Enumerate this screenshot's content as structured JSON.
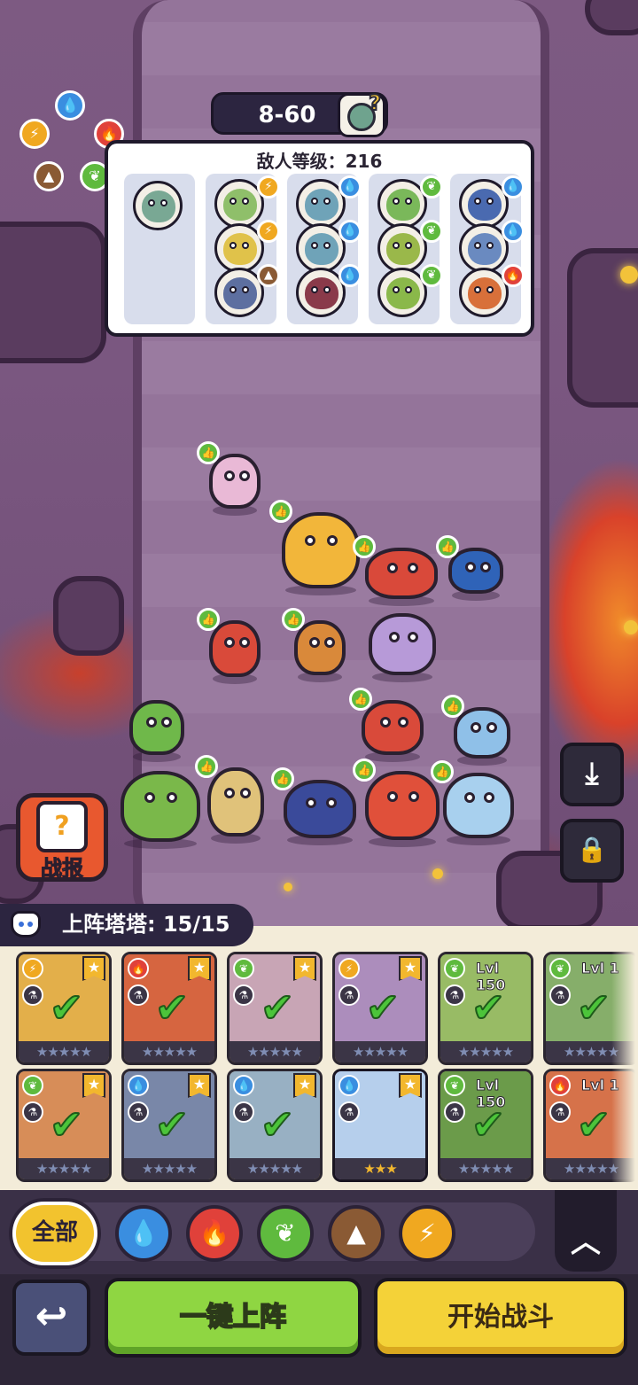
{
  "stage": {
    "label": "8-60"
  },
  "enemy_panel": {
    "level_text": "敌人等级：216",
    "columns": [
      {
        "tokens": [
          {
            "skin": "#79a894",
            "badge": null
          }
        ]
      },
      {
        "tokens": [
          {
            "skin": "#8fbf6a",
            "badge": "lightning"
          },
          {
            "skin": "#e0c24a",
            "badge": "lightning"
          },
          {
            "skin": "#5d6fa0",
            "badge": "earth"
          }
        ]
      },
      {
        "tokens": [
          {
            "skin": "#6fa3b8",
            "badge": "water"
          },
          {
            "skin": "#6fa3b8",
            "badge": "water"
          },
          {
            "skin": "#8a3a4a",
            "badge": "water"
          }
        ]
      },
      {
        "tokens": [
          {
            "skin": "#7ab85a",
            "badge": "leaf"
          },
          {
            "skin": "#9ab84a",
            "badge": "leaf"
          },
          {
            "skin": "#8ab84a",
            "badge": "leaf"
          }
        ]
      },
      {
        "tokens": [
          {
            "skin": "#4a6ab0",
            "badge": "water"
          },
          {
            "skin": "#6a8ac0",
            "badge": "water"
          },
          {
            "skin": "#d8703a",
            "badge": "fire"
          }
        ]
      }
    ]
  },
  "element_colors": {
    "water": "#3a8ee0",
    "fire": "#e0413a",
    "leaf": "#5fba3e",
    "earth": "#8a5a34",
    "lightning": "#f0a820"
  },
  "element_glyphs": {
    "water": "💧",
    "fire": "🔥",
    "leaf": "❦",
    "earth": "▲",
    "lightning": "⚡"
  },
  "battle_report": {
    "label": "战报",
    "icon": "?"
  },
  "deployed": {
    "label": "上阵塔塔: 15/15"
  },
  "cards": {
    "row1": [
      {
        "elem": "lightning",
        "art": "#e7b24a",
        "lvl": "",
        "stars": "★★★★★",
        "tag": true
      },
      {
        "elem": "fire",
        "art": "#d85a3e",
        "lvl": "",
        "stars": "★★★★★",
        "tag": true
      },
      {
        "elem": "leaf",
        "art": "#c8a6c8",
        "lvl": "",
        "stars": "★★★★★",
        "tag": true
      },
      {
        "elem": "lightning",
        "art": "#a78ad0",
        "lvl": "",
        "stars": "★★★★★",
        "tag": true
      },
      {
        "elem": "leaf",
        "art": "#8fbf6a",
        "lvl": "Lvl 150",
        "stars": "★★★★★",
        "tag": false
      },
      {
        "elem": "leaf",
        "art": "#7ab070",
        "lvl": "Lvl 1",
        "stars": "★★★★★",
        "tag": false
      }
    ],
    "row2": [
      {
        "elem": "leaf",
        "art": "#d9895a",
        "lvl": "",
        "stars": "★★★★★",
        "tag": true
      },
      {
        "elem": "water",
        "art": "#6b83b8",
        "lvl": "",
        "stars": "★★★★★",
        "tag": true
      },
      {
        "elem": "water",
        "art": "#8fb3d8",
        "lvl": "",
        "stars": "★★★★★",
        "tag": true
      },
      {
        "elem": "water",
        "art": "#b8e0f0",
        "lvl": "",
        "stars": "★★★",
        "tag": true,
        "special": true
      },
      {
        "elem": "leaf",
        "art": "#5a9a4a",
        "lvl": "Lvl 150",
        "stars": "★★★★★",
        "tag": false
      },
      {
        "elem": "fire",
        "art": "#d86a4a",
        "lvl": "Lvl 1",
        "stars": "★★★★★",
        "tag": false
      }
    ]
  },
  "filters": {
    "all_label": "全部",
    "icons": [
      "water",
      "fire",
      "leaf",
      "earth",
      "lightning"
    ]
  },
  "buttons": {
    "back_icon": "↩",
    "auto_deploy": "一键上阵",
    "start_battle": "开始战斗",
    "collapse_icon": "︿",
    "download_icon": "⤓",
    "lock_icon": "🔒"
  },
  "check_glyph": "✔",
  "thumb_glyph": "👍",
  "question_glyph": "?"
}
